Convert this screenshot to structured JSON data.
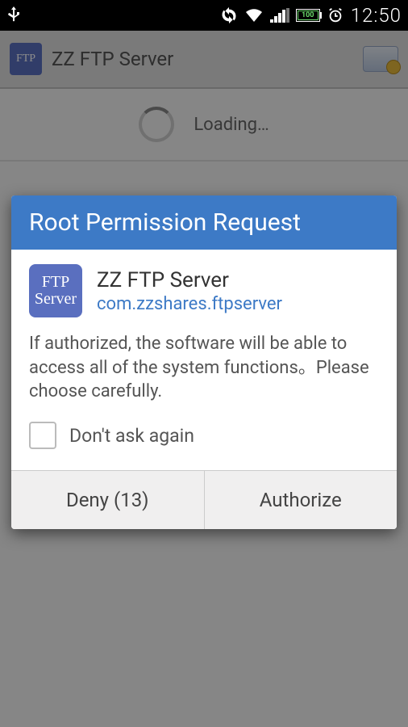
{
  "status": {
    "battery_text": "100",
    "clock": "12:50"
  },
  "action_bar": {
    "title": "ZZ FTP Server",
    "icon_text": "FTP\nServer"
  },
  "body": {
    "loading_text": "Loading…"
  },
  "dialog": {
    "title": "Root Permission Request",
    "app_icon_text": "FTP\nServer",
    "app_name": "ZZ FTP Server",
    "app_package": "com.zzshares.ftpserver",
    "message": "If authorized, the software will be able to access all of the system functions。Please choose carefully.",
    "checkbox_label": "Don't ask again",
    "deny_label": "Deny (13)",
    "authorize_label": "Authorize"
  }
}
